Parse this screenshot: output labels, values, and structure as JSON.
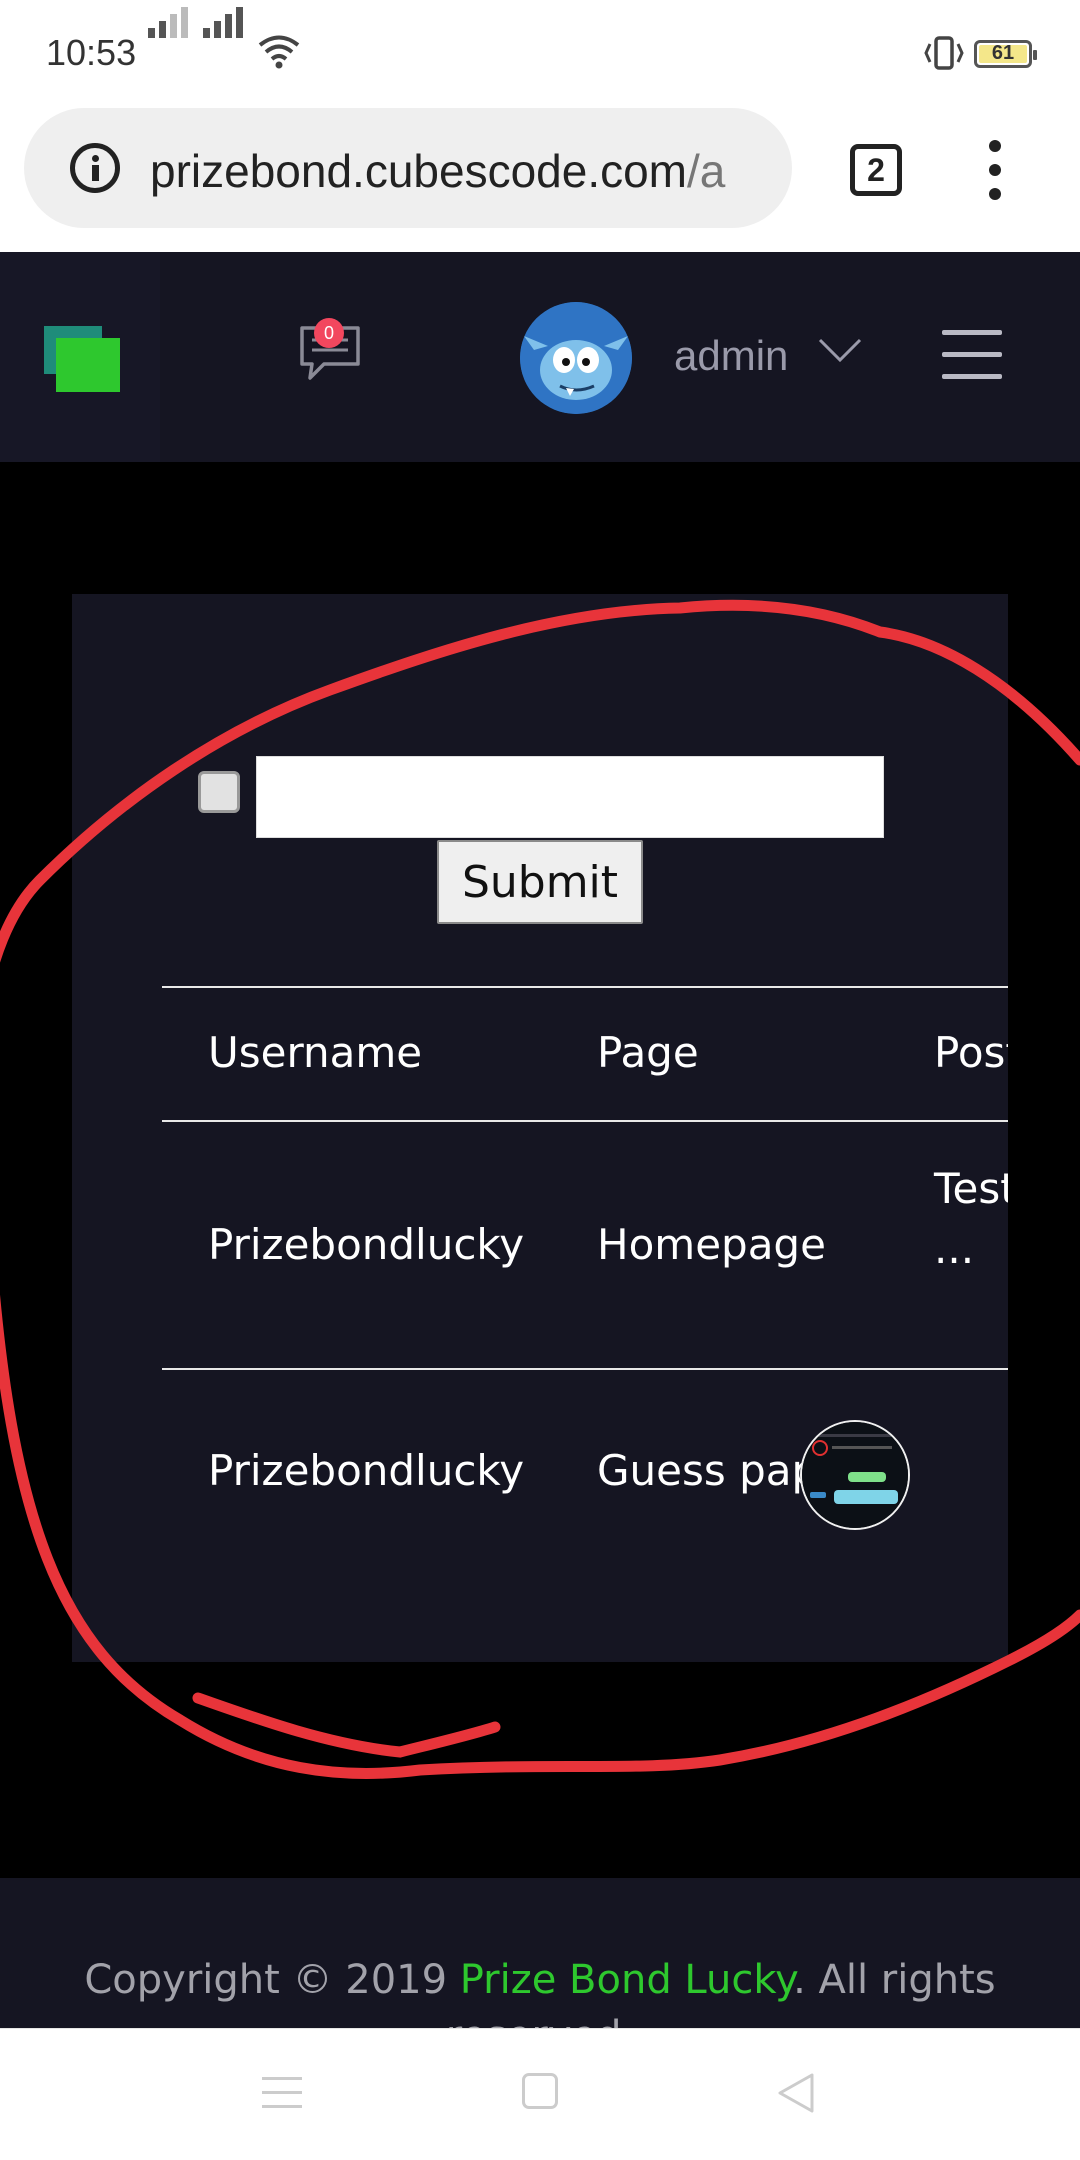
{
  "status_bar": {
    "time": "10:53",
    "battery": "61",
    "icons": [
      "signal-icon",
      "signal-icon",
      "wifi-icon",
      "vibrate-icon",
      "battery-icon"
    ]
  },
  "browser": {
    "url_host": "prizebond.cubescode.com",
    "url_rest": "/a",
    "tab_count": "2"
  },
  "header": {
    "notification_count": "0",
    "username": "admin",
    "colors": {
      "background": "#151522",
      "logo_green": "#2ec82e",
      "logo_teal": "#1f8c7a",
      "badge": "#f2475e"
    }
  },
  "form": {
    "input_value": "",
    "submit_label": "Submit"
  },
  "table": {
    "headers": [
      "Username",
      "Page",
      "Posting"
    ],
    "rows": [
      {
        "username": "Prizebondlucky",
        "page": "Homepage",
        "posting": "Test",
        "posting_more": "..."
      },
      {
        "username": "Prizebondlucky",
        "page": "Guess paper",
        "posting": "",
        "posting_image": "thumbnail-image"
      }
    ]
  },
  "footer": {
    "prefix": "Copyright © 2019 ",
    "brand": "Prize Bond Lucky",
    "suffix": ". All rights reserved."
  }
}
